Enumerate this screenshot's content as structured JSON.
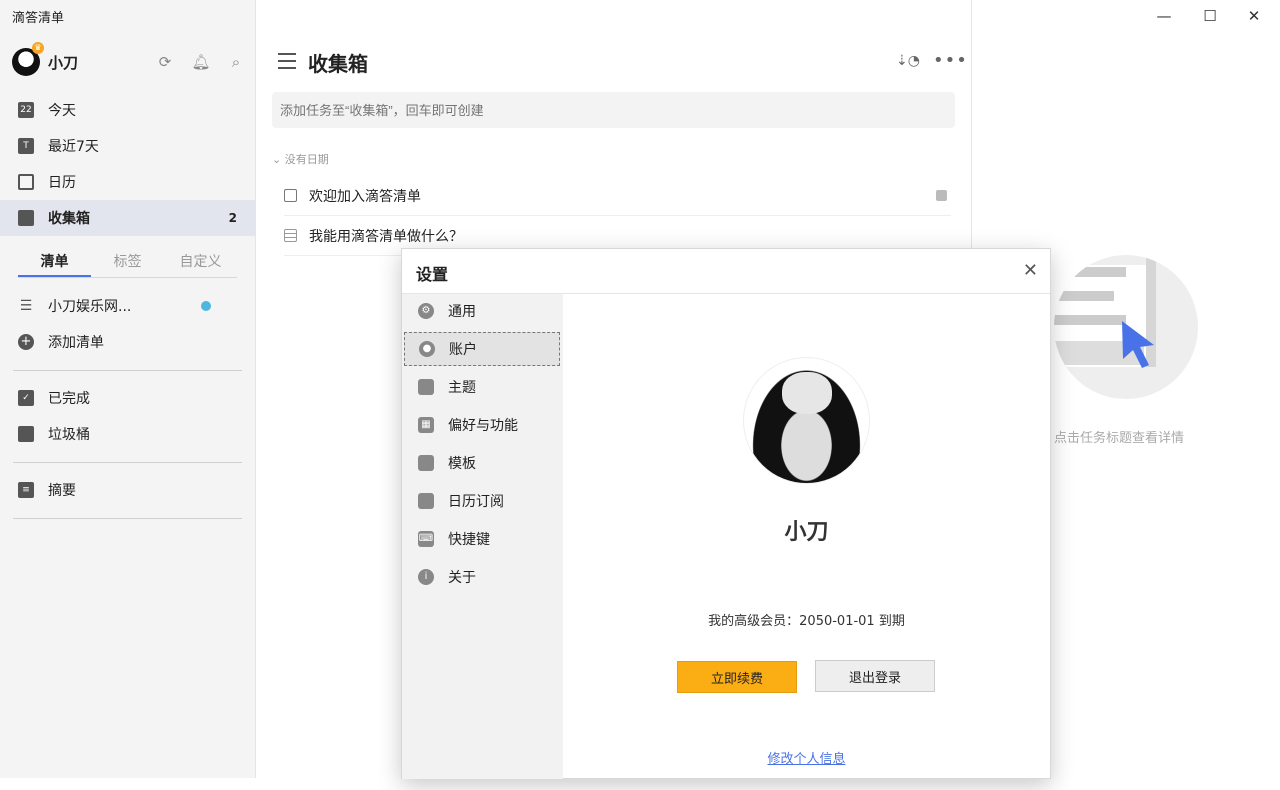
{
  "app": {
    "title": "滴答清单"
  },
  "user": {
    "name": "小刀"
  },
  "sidebar": {
    "nav": [
      {
        "label": "今天",
        "icon": "calendar-22-icon",
        "icon_text": "22"
      },
      {
        "label": "最近7天",
        "icon": "calendar-t-icon",
        "icon_text": "T"
      },
      {
        "label": "日历",
        "icon": "calendar-icon"
      },
      {
        "label": "收集箱",
        "icon": "inbox-icon",
        "count": "2"
      }
    ],
    "tabs": [
      "清单",
      "标签",
      "自定义"
    ],
    "lists": [
      {
        "label": "小刀娱乐网..."
      },
      {
        "label": "添加清单"
      }
    ],
    "bottom": [
      {
        "label": "已完成"
      },
      {
        "label": "垃圾桶"
      },
      {
        "label": "摘要"
      }
    ]
  },
  "main": {
    "title": "收集箱",
    "add_placeholder": "添加任务至“收集箱”，回车即可创建",
    "section": "没有日期",
    "tasks": [
      {
        "title": "欢迎加入滴答清单"
      },
      {
        "title": "我能用滴答清单做什么？"
      }
    ]
  },
  "detail": {
    "empty_hint": "点击任务标题查看详情"
  },
  "settings": {
    "title": "设置",
    "menu": [
      {
        "label": "通用",
        "icon": "gear-icon"
      },
      {
        "label": "账户",
        "icon": "user-icon"
      },
      {
        "label": "主题",
        "icon": "theme-icon"
      },
      {
        "label": "偏好与功能",
        "icon": "grid-icon"
      },
      {
        "label": "模板",
        "icon": "template-icon"
      },
      {
        "label": "日历订阅",
        "icon": "calendar-rss-icon"
      },
      {
        "label": "快捷键",
        "icon": "keyboard-icon"
      },
      {
        "label": "关于",
        "icon": "info-icon"
      }
    ],
    "account": {
      "name": "小刀",
      "membership": "我的高级会员：2050-01-01 到期",
      "renew_label": "立即续费",
      "logout_label": "退出登录",
      "edit_label": "修改个人信息"
    }
  }
}
